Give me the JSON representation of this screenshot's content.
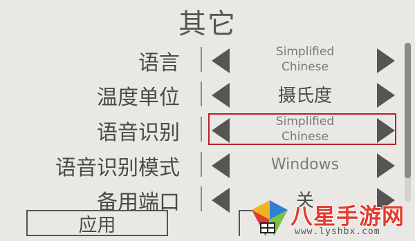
{
  "header": {
    "title": "其它"
  },
  "settings": [
    {
      "label": "语言",
      "value": "Simplified\nChinese"
    },
    {
      "label": "温度单位",
      "value": "摄氏度"
    },
    {
      "label": "语音识别",
      "value": "Simplified\nChinese"
    },
    {
      "label": "语音识别模式",
      "value": "Windows"
    },
    {
      "label": "备用端口",
      "value": "关"
    }
  ],
  "footer": {
    "apply_label": "应用"
  },
  "watermark": {
    "brand": "八星手游网",
    "url": "www.lyshbx.com"
  },
  "colors": {
    "background": "#e9e8e4",
    "highlight": "#b3232c",
    "watermark": "#e23b2f"
  }
}
